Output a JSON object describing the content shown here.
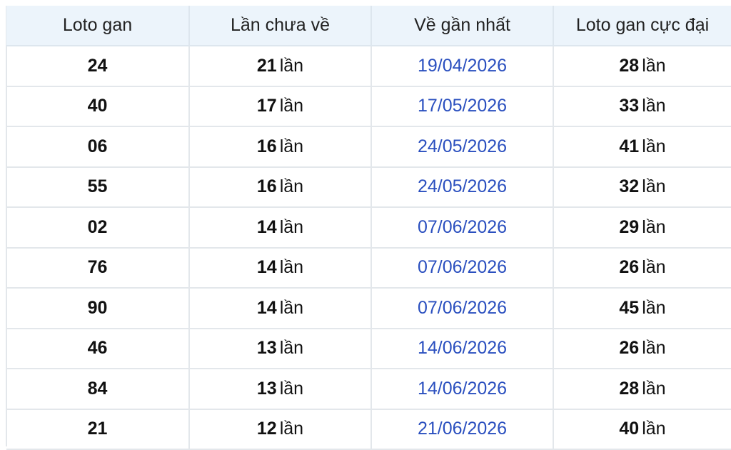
{
  "table": {
    "headers": [
      "Loto gan",
      "Lần chưa về",
      "Về gần nhất",
      "Loto gan cực đại"
    ],
    "unit": "lần",
    "rows": [
      {
        "loto": "24",
        "misses": "21",
        "last_date": "19/04/2026",
        "max_gap": "28"
      },
      {
        "loto": "40",
        "misses": "17",
        "last_date": "17/05/2026",
        "max_gap": "33"
      },
      {
        "loto": "06",
        "misses": "16",
        "last_date": "24/05/2026",
        "max_gap": "41"
      },
      {
        "loto": "55",
        "misses": "16",
        "last_date": "24/05/2026",
        "max_gap": "32"
      },
      {
        "loto": "02",
        "misses": "14",
        "last_date": "07/06/2026",
        "max_gap": "29"
      },
      {
        "loto": "76",
        "misses": "14",
        "last_date": "07/06/2026",
        "max_gap": "26"
      },
      {
        "loto": "90",
        "misses": "14",
        "last_date": "07/06/2026",
        "max_gap": "45"
      },
      {
        "loto": "46",
        "misses": "13",
        "last_date": "14/06/2026",
        "max_gap": "26"
      },
      {
        "loto": "84",
        "misses": "13",
        "last_date": "14/06/2026",
        "max_gap": "28"
      },
      {
        "loto": "21",
        "misses": "12",
        "last_date": "21/06/2026",
        "max_gap": "40"
      }
    ]
  }
}
